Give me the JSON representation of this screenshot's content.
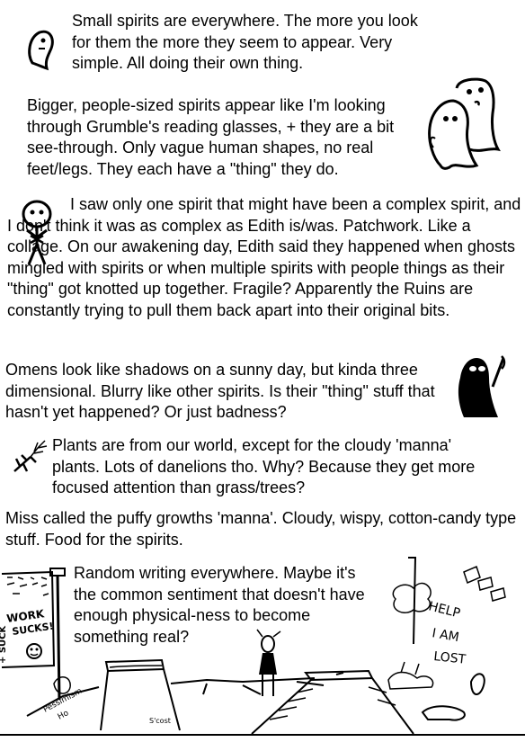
{
  "notes": {
    "small_spirits": "Small spirits are everywhere.  The more you look for them the more they seem to appear.  Very simple.  All doing their own thing.",
    "bigger_spirits": "Bigger, people-sized spirits appear like I'm looking through Grumble's reading glasses, + they are a bit see-through.  Only vague human shapes, no real feet/legs.  They each have a \"thing\" they do.",
    "complex_spirit": "I saw only one spirit that might have been a complex spirit, and I don't think it was as complex as Edith is/was. Patchwork.  Like a collage.  On our awakening day, Edith said they happened when ghosts mingled with spirits or when multiple spirits with people things as their \"thing\" got knotted up together.  Fragile?  Apparently the Ruins are constantly trying to pull them back apart into their original bits.",
    "omens": "Omens look like shadows on a sunny day, but kinda three dimensional.  Blurry like other spirits.  Is their \"thing\" stuff that hasn't yet happened?  Or just badness?",
    "plants": "Plants are from our world, except for the cloudy 'manna' plants.  Lots of danelions tho.  Why?  Because they get more focused attention than grass/trees?",
    "manna": "Miss called the puffy growths 'manna'.  Cloudy, wispy, cotton-candy type stuff.  Food for the spirits.",
    "writing": "Random writing everywhere.  Maybe it's the common sentiment that doesn't have enough physical-ness to become something real?"
  },
  "scribbles": {
    "work": "WORK",
    "sucks": "SUCKS!",
    "suck": "+ SUCK",
    "help": "HELP",
    "i_am": "I AM",
    "lost": "LOST",
    "pessimism": "Pessimism",
    "pessimism_2": "Ho",
    "doodle": "S'cost"
  }
}
